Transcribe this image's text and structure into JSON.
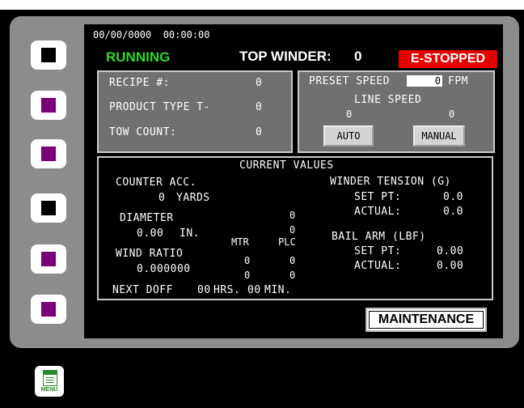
{
  "header": {
    "datetime": "00/00/0000  00:00:00",
    "status": "RUNNING",
    "winder_label": "TOP WINDER:",
    "winder_number": "0",
    "estop": "E-STOPPED"
  },
  "recipe_box": {
    "recipe_label": "RECIPE #:",
    "recipe_value": "0",
    "product_label": "PRODUCT TYPE T-",
    "product_value": "0",
    "tow_label": "TOW COUNT:",
    "tow_value": "0"
  },
  "speed_box": {
    "preset_label": "PRESET SPEED",
    "preset_value": "0",
    "preset_unit": "FPM",
    "line_speed_label": "LINE SPEED",
    "line_speed_left": "0",
    "line_speed_right": "0",
    "auto_label": "AUTO",
    "manual_label": "MANUAL"
  },
  "current_values": {
    "title": "CURRENT VALUES",
    "counter_label": "COUNTER ACC.",
    "counter_value": "0",
    "counter_unit": "YARDS",
    "diameter_label": "DIAMETER",
    "diameter_value": "0.00",
    "diameter_unit": "IN.",
    "wind_ratio_label": "WIND RATIO",
    "wind_ratio_value": "0.000000",
    "mtr_label": "MTR",
    "plc_label": "PLC",
    "plc_top1": "0",
    "plc_top2": "0",
    "mtr_val1": "0",
    "mtr_val2": "0",
    "plc_val1": "0",
    "plc_val2": "0",
    "next_doff_label": "NEXT DOFF",
    "next_doff_hrs": "00",
    "hrs_label": "HRS.",
    "next_doff_min": "00",
    "min_label": "MIN.",
    "tension_label": "WINDER TENSION (G)",
    "tension_set_label": "SET PT:",
    "tension_set_value": "0.0",
    "tension_actual_label": "ACTUAL:",
    "tension_actual_value": "0.0",
    "bail_label": "BAIL ARM (LBF)",
    "bail_set_label": "SET PT:",
    "bail_set_value": "0.00",
    "bail_actual_label": "ACTUAL:",
    "bail_actual_value": "0.00"
  },
  "maintenance_label": "MAINTENANCE",
  "menu_label": "MENU",
  "side_buttons": [
    {
      "color": "#000000"
    },
    {
      "color": "#7a007a"
    },
    {
      "color": "#7a007a"
    },
    {
      "color": "#000000"
    },
    {
      "color": "#7a007a"
    },
    {
      "color": "#7a007a"
    }
  ]
}
